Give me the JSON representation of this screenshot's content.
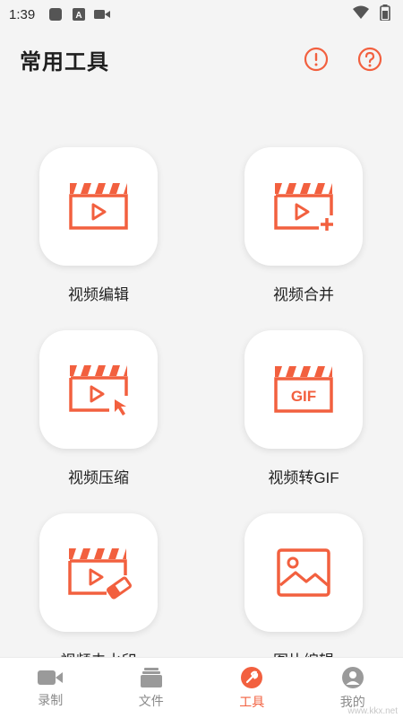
{
  "status": {
    "time": "1:39",
    "icons": [
      "square-icon",
      "a-icon",
      "video-icon",
      "wifi-icon",
      "battery-icon"
    ]
  },
  "header": {
    "title": "常用工具",
    "actions": [
      "info-icon",
      "help-icon"
    ]
  },
  "accent": "#f2603f",
  "tools": [
    {
      "label": "视频编辑",
      "icon": "clapper-play-icon"
    },
    {
      "label": "视频合并",
      "icon": "clapper-plus-icon"
    },
    {
      "label": "视频压缩",
      "icon": "clapper-cursor-icon"
    },
    {
      "label": "视频转GIF",
      "icon": "clapper-gif-icon",
      "icon_text": "GIF"
    },
    {
      "label": "视频去水印",
      "icon": "clapper-eraser-icon"
    },
    {
      "label": "图片编辑",
      "icon": "image-icon"
    }
  ],
  "nav": {
    "items": [
      {
        "label": "录制",
        "icon": "camera-icon",
        "active": false
      },
      {
        "label": "文件",
        "icon": "folder-icon",
        "active": false
      },
      {
        "label": "工具",
        "icon": "wrench-icon",
        "active": true
      },
      {
        "label": "我的",
        "icon": "user-icon",
        "active": false
      }
    ]
  },
  "watermark": "www.kkx.net"
}
